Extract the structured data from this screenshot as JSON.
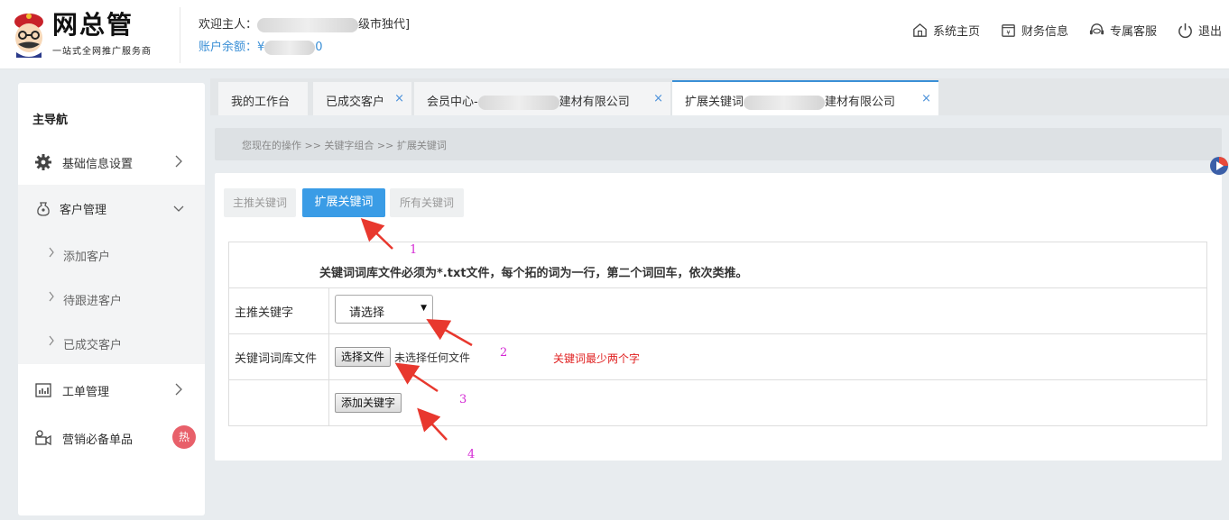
{
  "header": {
    "logo_title": "网总管",
    "logo_subtitle": "一站式全网推广服务商",
    "welcome_prefix": "欢迎主人：",
    "welcome_suffix": "级市独代]",
    "balance_prefix": "账户余额：¥",
    "balance_suffix": "0",
    "links": [
      {
        "label": "系统主页",
        "icon": "home-icon"
      },
      {
        "label": "财务信息",
        "icon": "finance-icon"
      },
      {
        "label": "专属客服",
        "icon": "headset-icon"
      },
      {
        "label": "退出",
        "icon": "power-icon"
      }
    ]
  },
  "sidebar": {
    "title": "主导航",
    "items": [
      {
        "label": "基础信息设置",
        "icon": "gear-icon"
      },
      {
        "label": "客户管理",
        "icon": "user-bag-icon"
      },
      {
        "label": "工单管理",
        "icon": "chart-icon"
      },
      {
        "label": "营销必备单品",
        "icon": "camera-icon",
        "badge": "热"
      }
    ],
    "sub_items": [
      "添加客户",
      "待跟进客户",
      "已成交客户"
    ]
  },
  "tabs": [
    {
      "label": "我的工作台",
      "closable": false
    },
    {
      "label": "已成交客户",
      "closable": true
    },
    {
      "label_prefix": "会员中心-",
      "label_suffix": "建材有限公司",
      "closable": true
    },
    {
      "label_prefix": "扩展关键词",
      "label_suffix": "建材有限公司",
      "closable": true,
      "active": true
    }
  ],
  "close_glyph": "×",
  "breadcrumb": "您现在的操作 >> 关键字组合 >> 扩展关键词",
  "subtabs": [
    "主推关键词",
    "扩展关键词",
    "所有关键词"
  ],
  "form": {
    "notice": "关键词词库文件必须为*.txt文件，每个拓的词为一行，第二个词回车，依次类推。",
    "main_keyword_label": "主推关键字",
    "select_value": "请选择",
    "file_label": "关键词词库文件",
    "file_button": "选择文件",
    "file_status": "未选择任何文件",
    "file_hint": "关键词最少两个字",
    "submit_button": "添加关键字"
  },
  "annotations": [
    "1",
    "2",
    "3",
    "4"
  ],
  "colors": {
    "accent": "#3a9ce6",
    "alert": "#e02020",
    "annotation_arrow": "#e8382e",
    "annotation_number": "#d42ad4"
  }
}
